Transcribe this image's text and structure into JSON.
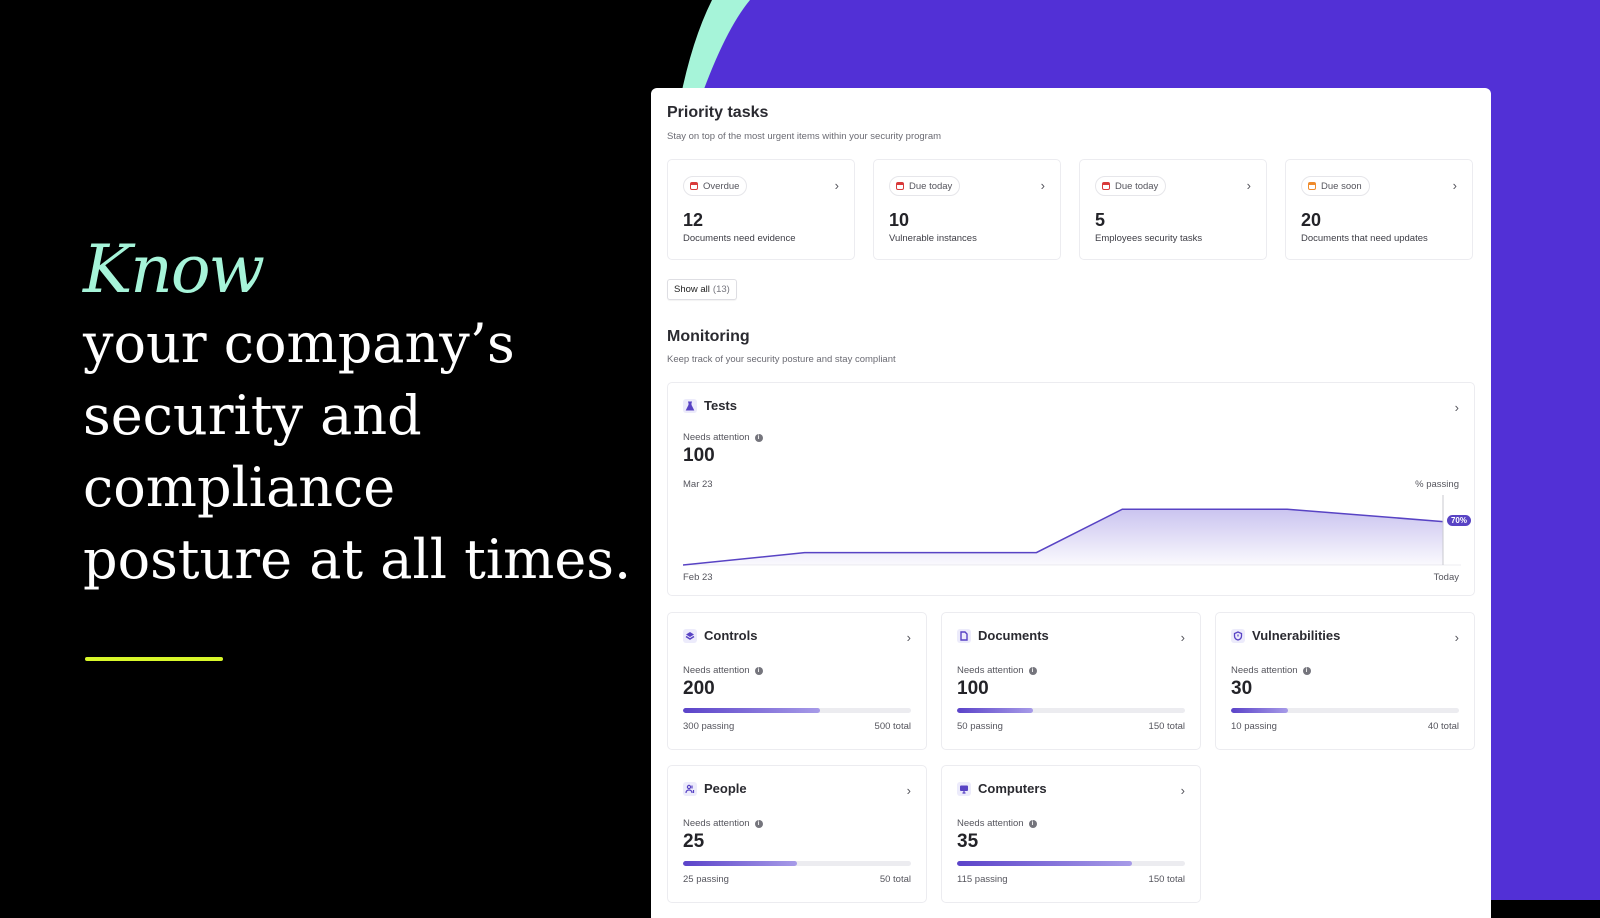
{
  "colors": {
    "purple_bg": "#5230d6",
    "mint": "#a6f4d9",
    "accent_line": "#d8f72a",
    "chart_line": "#5843c4"
  },
  "hero": {
    "emphasis": "Know",
    "lines": [
      "your company’s",
      "security and",
      "compliance",
      "posture at all times."
    ]
  },
  "priority": {
    "title": "Priority tasks",
    "subtitle": "Stay on top of the most urgent items within your security program",
    "cards": [
      {
        "status": "Overdue",
        "status_color": "red",
        "count": "12",
        "label": "Documents need evidence"
      },
      {
        "status": "Due today",
        "status_color": "red",
        "count": "10",
        "label": "Vulnerable instances"
      },
      {
        "status": "Due today",
        "status_color": "red",
        "count": "5",
        "label": "Employees security tasks"
      },
      {
        "status": "Due soon",
        "status_color": "orange",
        "count": "20",
        "label": "Documents that need updates"
      }
    ],
    "show_all_label": "Show all",
    "show_all_count": "(13)"
  },
  "monitoring": {
    "title": "Monitoring",
    "subtitle": "Keep track of your security posture and stay compliant",
    "tests": {
      "title": "Tests",
      "needs_attention_label": "Needs attention",
      "value": "100",
      "top_left_label": "Mar 23",
      "top_right_label": "% passing",
      "bottom_left_label": "Feb 23",
      "bottom_right_label": "Today",
      "current_tag": "70%"
    },
    "cards": [
      {
        "title": "Controls",
        "icon": "controls-icon",
        "needs_attention_label": "Needs attention",
        "value": "200",
        "passing": "300 passing",
        "total": "500 total",
        "fraction": 0.6
      },
      {
        "title": "Documents",
        "icon": "document-icon",
        "needs_attention_label": "Needs attention",
        "value": "100",
        "passing": "50 passing",
        "total": "150 total",
        "fraction": 0.3333
      },
      {
        "title": "Vulnerabilities",
        "icon": "shield-icon",
        "needs_attention_label": "Needs attention",
        "value": "30",
        "passing": "10 passing",
        "total": "40 total",
        "fraction": 0.25
      },
      {
        "title": "People",
        "icon": "people-icon",
        "needs_attention_label": "Needs attention",
        "value": "25",
        "passing": "25 passing",
        "total": "50 total",
        "fraction": 0.5
      },
      {
        "title": "Computers",
        "icon": "computer-icon",
        "needs_attention_label": "Needs attention",
        "value": "35",
        "passing": "115 passing",
        "total": "150 total",
        "fraction": 0.7667
      }
    ]
  },
  "chart_data": {
    "type": "area",
    "title": "Tests",
    "xlabel": "",
    "ylabel": "% passing",
    "x": [
      "Feb 23",
      "",
      "",
      "",
      "",
      "Today"
    ],
    "x_positions": [
      0,
      0.16,
      0.465,
      0.578,
      0.795,
      1.0
    ],
    "values": [
      0,
      20,
      20,
      90,
      90,
      70
    ],
    "ylim": [
      0,
      100
    ],
    "grid": false,
    "annotations": [
      "70%"
    ]
  }
}
